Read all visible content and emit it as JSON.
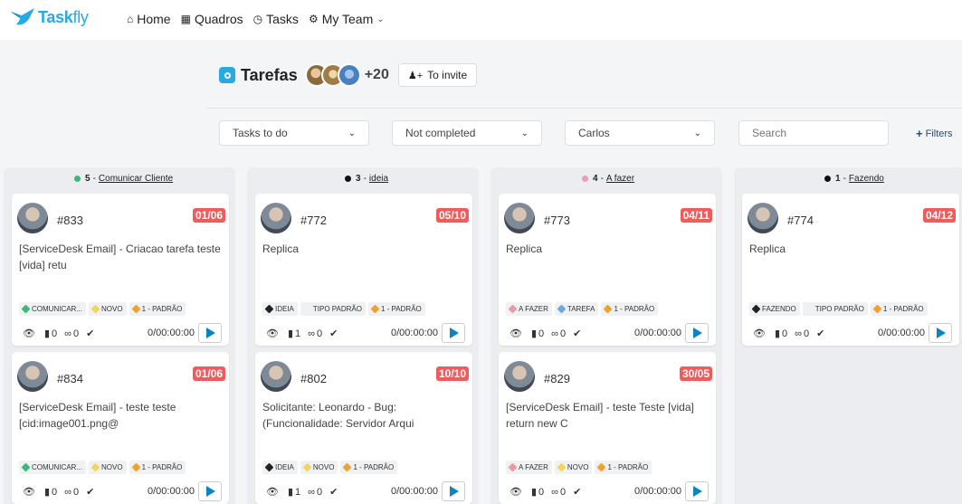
{
  "app": {
    "logo_text_a": "Task",
    "logo_text_b": "fly"
  },
  "nav": [
    {
      "icon": "home-icon",
      "glyph": "🏠",
      "label": "Home"
    },
    {
      "icon": "grid-icon",
      "glyph": "▦",
      "label": "Quadros"
    },
    {
      "icon": "clock-icon",
      "glyph": "⏱",
      "label": "Tasks"
    },
    {
      "icon": "gear-icon",
      "glyph": "⚙",
      "label": "My Team"
    }
  ],
  "board": {
    "title": "Tarefas",
    "extra_members": "+20",
    "invite_label": "To invite"
  },
  "filters": {
    "status": "Tasks to do",
    "completion": "Not completed",
    "user": "Carlos",
    "search_placeholder": "Search",
    "filters_label": "Filters"
  },
  "columns": [
    {
      "count": "5",
      "name": "Comunicar Cliente",
      "dot_color": "#4caf7a",
      "cards": [
        {
          "id": "#833",
          "due": "01/06",
          "desc": "[ServiceDesk Email] - Criacao tarefa teste [vida] retu",
          "tags": [
            [
              "COMUNICAR...",
              "#3cb878"
            ],
            [
              "NOVO",
              "#f4d35e"
            ],
            [
              "1 - PADRÃO",
              "#f0a030"
            ]
          ],
          "views": "0",
          "comments": "0",
          "attachments": "0",
          "time": "0/00:00:00"
        },
        {
          "id": "#834",
          "due": "01/06",
          "desc": "[ServiceDesk Email] - teste teste [cid:image001.png@",
          "tags": [
            [
              "COMUNICAR...",
              "#3cb878"
            ],
            [
              "NOVO",
              "#f4d35e"
            ],
            [
              "1 - PADRÃO",
              "#f0a030"
            ]
          ],
          "views": "0",
          "comments": "0",
          "attachments": "0",
          "time": "0/00:00:00"
        }
      ]
    },
    {
      "count": "3",
      "name": "ideia",
      "dot_color": "#111111",
      "cards": [
        {
          "id": "#772",
          "due": "05/10",
          "desc": "Replica",
          "tags": [
            [
              "IDEIA",
              "#222222"
            ],
            [
              "TIPO PADRÃO",
              "#f0f1f3"
            ],
            [
              "1 - PADRÃO",
              "#f0a030"
            ]
          ],
          "views": "1",
          "comments": "0",
          "attachments": "0",
          "time": "0/00:00:00"
        },
        {
          "id": "#802",
          "due": "10/10",
          "desc": "Solicitante: Leonardo - Bug: (Funcionalidade: Servidor Arqui",
          "tags": [
            [
              "IDEIA",
              "#222222"
            ],
            [
              "NOVO",
              "#f4d35e"
            ],
            [
              "1 - PADRÃO",
              "#f0a030"
            ]
          ],
          "views": "1",
          "comments": "0",
          "attachments": "0",
          "time": "0/00:00:00"
        }
      ]
    },
    {
      "count": "4",
      "name": "A fazer",
      "dot_color": "#e8a0b0",
      "cards": [
        {
          "id": "#773",
          "due": "04/11",
          "desc": "Replica",
          "tags": [
            [
              "A FAZER",
              "#e89aa8"
            ],
            [
              "TAREFA",
              "#6aa8e0"
            ],
            [
              "1 - PADRÃO",
              "#f0a030"
            ]
          ],
          "views": "0",
          "comments": "0",
          "attachments": "0",
          "time": "0/00:00:00"
        },
        {
          "id": "#829",
          "due": "30/05",
          "desc": "[ServiceDesk Email] - teste Teste [vida] return new C",
          "tags": [
            [
              "A FAZER",
              "#e89aa8"
            ],
            [
              "NOVO",
              "#f4d35e"
            ],
            [
              "1 - PADRÃO",
              "#f0a030"
            ]
          ],
          "views": "0",
          "comments": "0",
          "attachments": "0",
          "time": "0/00:00:00"
        }
      ]
    },
    {
      "count": "1",
      "name": "Fazendo",
      "dot_color": "#111111",
      "cards": [
        {
          "id": "#774",
          "due": "04/12",
          "desc": "Replica",
          "tags": [
            [
              "FAZENDO",
              "#222222"
            ],
            [
              "TIPO PADRÃO",
              "#f0f1f3"
            ],
            [
              "1 - PADRÃO",
              "#f0a030"
            ]
          ],
          "views": "0",
          "comments": "0",
          "attachments": "0",
          "time": "0/00:00:00"
        }
      ]
    }
  ]
}
